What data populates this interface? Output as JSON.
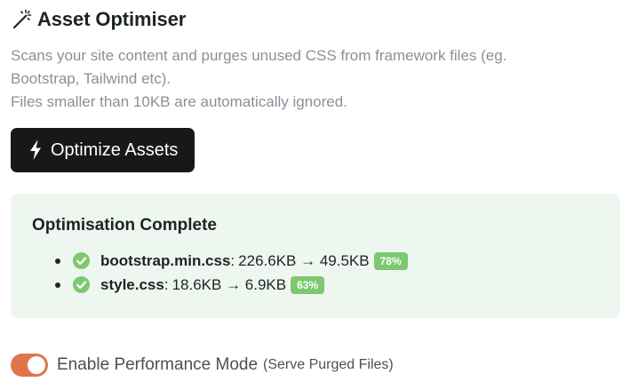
{
  "header": {
    "title": "Asset Optimiser",
    "icon": "magic-wand-icon"
  },
  "description": {
    "line1": "Scans your site content and purges unused CSS from framework files (eg.",
    "line2": "Bootstrap, Tailwind etc).",
    "line3": "Files smaller than 10KB are automatically ignored."
  },
  "optimize_button": {
    "label": "Optimize Assets",
    "icon": "lightning-bolt-icon"
  },
  "result": {
    "title": "Optimisation Complete",
    "files": [
      {
        "name": "bootstrap.min.css",
        "sizes": "226.6KB → 49.5KB",
        "badge": "78%"
      },
      {
        "name": "style.css",
        "sizes": "18.6KB → 6.9KB",
        "badge": "63%"
      }
    ]
  },
  "performance_mode": {
    "label": "Enable Performance Mode",
    "note": "(Serve Purged Files)",
    "enabled": true
  },
  "colors": {
    "primary_button": "#17181a",
    "panel_bg": "#eef7ef",
    "check": "#7ec870",
    "badge": "#7ec870",
    "toggle_on": "#e0754a",
    "muted_text": "#8a9098"
  }
}
